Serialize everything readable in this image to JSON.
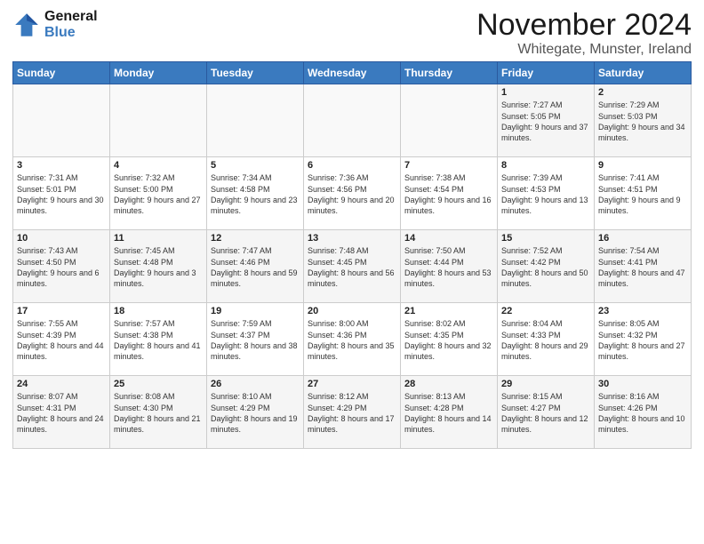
{
  "header": {
    "logo_line1": "General",
    "logo_line2": "Blue",
    "month_title": "November 2024",
    "location": "Whitegate, Munster, Ireland"
  },
  "weekdays": [
    "Sunday",
    "Monday",
    "Tuesday",
    "Wednesday",
    "Thursday",
    "Friday",
    "Saturday"
  ],
  "weeks": [
    [
      {
        "day": "",
        "info": ""
      },
      {
        "day": "",
        "info": ""
      },
      {
        "day": "",
        "info": ""
      },
      {
        "day": "",
        "info": ""
      },
      {
        "day": "",
        "info": ""
      },
      {
        "day": "1",
        "info": "Sunrise: 7:27 AM\nSunset: 5:05 PM\nDaylight: 9 hours and 37 minutes."
      },
      {
        "day": "2",
        "info": "Sunrise: 7:29 AM\nSunset: 5:03 PM\nDaylight: 9 hours and 34 minutes."
      }
    ],
    [
      {
        "day": "3",
        "info": "Sunrise: 7:31 AM\nSunset: 5:01 PM\nDaylight: 9 hours and 30 minutes."
      },
      {
        "day": "4",
        "info": "Sunrise: 7:32 AM\nSunset: 5:00 PM\nDaylight: 9 hours and 27 minutes."
      },
      {
        "day": "5",
        "info": "Sunrise: 7:34 AM\nSunset: 4:58 PM\nDaylight: 9 hours and 23 minutes."
      },
      {
        "day": "6",
        "info": "Sunrise: 7:36 AM\nSunset: 4:56 PM\nDaylight: 9 hours and 20 minutes."
      },
      {
        "day": "7",
        "info": "Sunrise: 7:38 AM\nSunset: 4:54 PM\nDaylight: 9 hours and 16 minutes."
      },
      {
        "day": "8",
        "info": "Sunrise: 7:39 AM\nSunset: 4:53 PM\nDaylight: 9 hours and 13 minutes."
      },
      {
        "day": "9",
        "info": "Sunrise: 7:41 AM\nSunset: 4:51 PM\nDaylight: 9 hours and 9 minutes."
      }
    ],
    [
      {
        "day": "10",
        "info": "Sunrise: 7:43 AM\nSunset: 4:50 PM\nDaylight: 9 hours and 6 minutes."
      },
      {
        "day": "11",
        "info": "Sunrise: 7:45 AM\nSunset: 4:48 PM\nDaylight: 9 hours and 3 minutes."
      },
      {
        "day": "12",
        "info": "Sunrise: 7:47 AM\nSunset: 4:46 PM\nDaylight: 8 hours and 59 minutes."
      },
      {
        "day": "13",
        "info": "Sunrise: 7:48 AM\nSunset: 4:45 PM\nDaylight: 8 hours and 56 minutes."
      },
      {
        "day": "14",
        "info": "Sunrise: 7:50 AM\nSunset: 4:44 PM\nDaylight: 8 hours and 53 minutes."
      },
      {
        "day": "15",
        "info": "Sunrise: 7:52 AM\nSunset: 4:42 PM\nDaylight: 8 hours and 50 minutes."
      },
      {
        "day": "16",
        "info": "Sunrise: 7:54 AM\nSunset: 4:41 PM\nDaylight: 8 hours and 47 minutes."
      }
    ],
    [
      {
        "day": "17",
        "info": "Sunrise: 7:55 AM\nSunset: 4:39 PM\nDaylight: 8 hours and 44 minutes."
      },
      {
        "day": "18",
        "info": "Sunrise: 7:57 AM\nSunset: 4:38 PM\nDaylight: 8 hours and 41 minutes."
      },
      {
        "day": "19",
        "info": "Sunrise: 7:59 AM\nSunset: 4:37 PM\nDaylight: 8 hours and 38 minutes."
      },
      {
        "day": "20",
        "info": "Sunrise: 8:00 AM\nSunset: 4:36 PM\nDaylight: 8 hours and 35 minutes."
      },
      {
        "day": "21",
        "info": "Sunrise: 8:02 AM\nSunset: 4:35 PM\nDaylight: 8 hours and 32 minutes."
      },
      {
        "day": "22",
        "info": "Sunrise: 8:04 AM\nSunset: 4:33 PM\nDaylight: 8 hours and 29 minutes."
      },
      {
        "day": "23",
        "info": "Sunrise: 8:05 AM\nSunset: 4:32 PM\nDaylight: 8 hours and 27 minutes."
      }
    ],
    [
      {
        "day": "24",
        "info": "Sunrise: 8:07 AM\nSunset: 4:31 PM\nDaylight: 8 hours and 24 minutes."
      },
      {
        "day": "25",
        "info": "Sunrise: 8:08 AM\nSunset: 4:30 PM\nDaylight: 8 hours and 21 minutes."
      },
      {
        "day": "26",
        "info": "Sunrise: 8:10 AM\nSunset: 4:29 PM\nDaylight: 8 hours and 19 minutes."
      },
      {
        "day": "27",
        "info": "Sunrise: 8:12 AM\nSunset: 4:29 PM\nDaylight: 8 hours and 17 minutes."
      },
      {
        "day": "28",
        "info": "Sunrise: 8:13 AM\nSunset: 4:28 PM\nDaylight: 8 hours and 14 minutes."
      },
      {
        "day": "29",
        "info": "Sunrise: 8:15 AM\nSunset: 4:27 PM\nDaylight: 8 hours and 12 minutes."
      },
      {
        "day": "30",
        "info": "Sunrise: 8:16 AM\nSunset: 4:26 PM\nDaylight: 8 hours and 10 minutes."
      }
    ]
  ]
}
